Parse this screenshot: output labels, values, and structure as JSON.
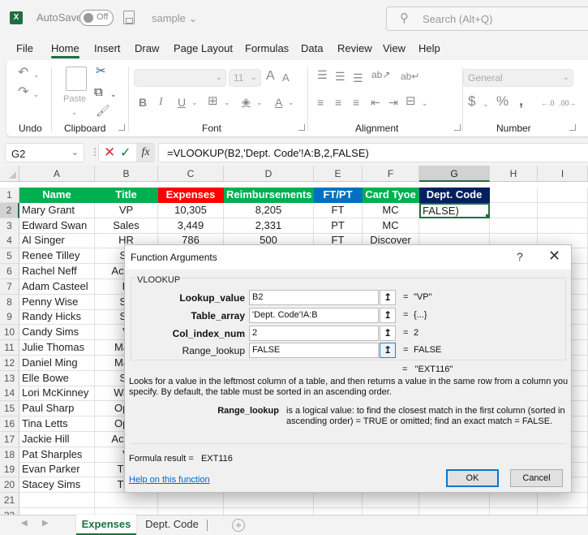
{
  "titlebar": {
    "app_icon": "excel-logo-icon",
    "autosave_label": "AutoSave",
    "autosave_state": "Off",
    "filename": "sample",
    "filename_caret": "⌄",
    "search_placeholder": "Search (Alt+Q)"
  },
  "menu": [
    "File",
    "Home",
    "Insert",
    "Draw",
    "Page Layout",
    "Formulas",
    "Data",
    "Review",
    "View",
    "Help"
  ],
  "menu_active": "Home",
  "ribbon": {
    "groups": [
      "Undo",
      "Clipboard",
      "Font",
      "Alignment",
      "Number"
    ],
    "paste_label": "Paste",
    "font_name": "",
    "font_size": "11",
    "number_format": "General"
  },
  "formula_bar": {
    "name_box": "G2",
    "formula": "=VLOOKUP(B2,'Dept. Code'!A:B,2,FALSE)"
  },
  "sheet": {
    "columns": [
      "A",
      "B",
      "C",
      "D",
      "E",
      "F",
      "G",
      "H",
      "I"
    ],
    "selected_column": "G",
    "selected_row": 2,
    "header_row": [
      {
        "text": "Name",
        "bg": "#00b050"
      },
      {
        "text": "Title",
        "bg": "#00b050"
      },
      {
        "text": "Expenses",
        "bg": "#ff0000"
      },
      {
        "text": "Reimbursements",
        "bg": "#00b050"
      },
      {
        "text": "FT/PT",
        "bg": "#0070c0"
      },
      {
        "text": "Card Tyoe",
        "bg": "#00b050"
      },
      {
        "text": "Dept. Code",
        "bg": "#002060"
      }
    ],
    "rows": [
      [
        "Mary Grant",
        "VP",
        "10,305",
        "8,205",
        "FT",
        "MC",
        "FALSE)"
      ],
      [
        "Edward Swan",
        "Sales",
        "3,449",
        "2,331",
        "PT",
        "MC",
        ""
      ],
      [
        "Al Singer",
        "HR",
        "786",
        "500",
        "FT",
        "Discover",
        ""
      ],
      [
        "Renee Tilley",
        "Sa",
        "",
        "",
        "",
        "",
        ""
      ],
      [
        "Rachel Neff",
        "Accou",
        "",
        "",
        "",
        "",
        ""
      ],
      [
        "Adam Casteel",
        "H",
        "",
        "",
        "",
        "",
        ""
      ],
      [
        "Penny Wise",
        "Sa",
        "",
        "",
        "",
        "",
        ""
      ],
      [
        "Randy Hicks",
        "Sa",
        "",
        "",
        "",
        "",
        ""
      ],
      [
        "Candy Sims",
        "V",
        "",
        "",
        "",
        "",
        ""
      ],
      [
        "Julie Thomas",
        "Mark",
        "",
        "",
        "",
        "",
        ""
      ],
      [
        "Daniel Ming",
        "Mark",
        "",
        "",
        "",
        "",
        ""
      ],
      [
        "Elle Bowe",
        "Sa",
        "",
        "",
        "",
        "",
        ""
      ],
      [
        "Lori McKinney",
        "Ware",
        "",
        "",
        "",
        "",
        ""
      ],
      [
        "Paul Sharp",
        "Oper",
        "",
        "",
        "",
        "",
        ""
      ],
      [
        "Tina Letts",
        "Oper",
        "",
        "",
        "",
        "",
        ""
      ],
      [
        "Jackie Hill",
        "Accou",
        "",
        "",
        "",
        "",
        ""
      ],
      [
        "Pat Sharples",
        "V",
        "",
        "",
        "",
        "",
        ""
      ],
      [
        "Evan Parker",
        "Trai",
        "",
        "",
        "",
        "",
        ""
      ],
      [
        "Stacey Sims",
        "Trai",
        "",
        "",
        "",
        "",
        ""
      ],
      [
        "",
        "",
        "",
        "",
        "",
        "",
        ""
      ],
      [
        "",
        "",
        "",
        "",
        "",
        "",
        ""
      ]
    ],
    "row_numbers": [
      1,
      2,
      3,
      4,
      5,
      6,
      7,
      8,
      9,
      10,
      11,
      12,
      13,
      14,
      15,
      16,
      17,
      18,
      19,
      20,
      21,
      22
    ]
  },
  "tabs": {
    "sheets": [
      "Expenses",
      "Dept. Code"
    ],
    "active": "Expenses",
    "add_label": "+"
  },
  "dialog": {
    "title": "Function Arguments",
    "help_glyph": "?",
    "close_glyph": "✕",
    "function_name": "VLOOKUP",
    "args": [
      {
        "label": "Lookup_value",
        "bold": true,
        "value": "B2",
        "result": "\"VP\""
      },
      {
        "label": "Table_array",
        "bold": true,
        "value": "'Dept. Code'!A:B",
        "result": "{...}"
      },
      {
        "label": "Col_index_num",
        "bold": true,
        "value": "2",
        "result": "2"
      },
      {
        "label": "Range_lookup",
        "bold": false,
        "value": "FALSE",
        "result": "FALSE"
      }
    ],
    "result_line": "\"EXT116\"",
    "description": "Looks for a value in the leftmost column of a table, and then returns a value in the same row from a column you specify. By default, the table must be sorted in an ascending order.",
    "current_arg_name": "Range_lookup",
    "current_arg_help": "is a logical value: to find the closest match in the first column (sorted in ascending order) = TRUE or omitted; find an exact match = FALSE.",
    "formula_result_label": "Formula result =",
    "formula_result_value": "EXT116",
    "help_link": "Help on this function",
    "ok_label": "OK",
    "cancel_label": "Cancel"
  }
}
